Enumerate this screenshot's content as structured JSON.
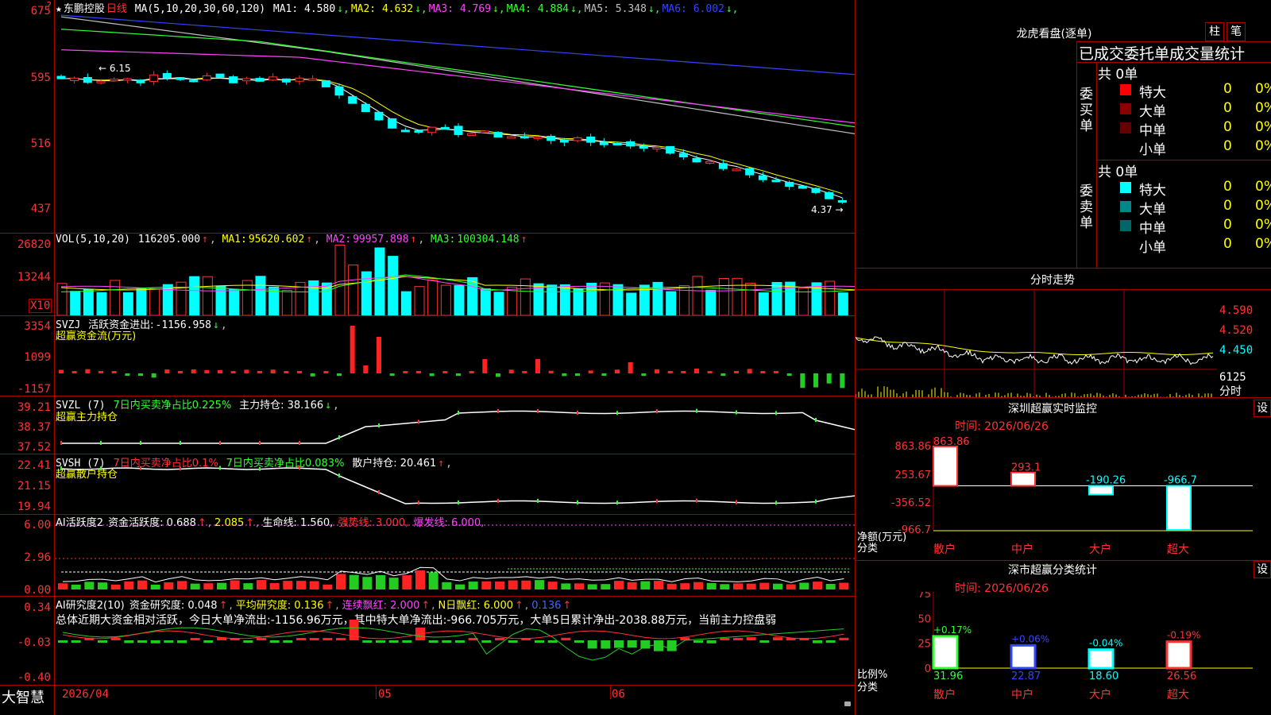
{
  "app": {
    "brand": "大智慧"
  },
  "main_chart": {
    "star": "★",
    "stock_name": "东鹏控股",
    "period": "日线",
    "ma_label": "MA(5,10,20,30,60,120)",
    "ma_values": [
      {
        "label": "MA1:",
        "value": "4.580",
        "arrow": "↓",
        "color": "#ffffff"
      },
      {
        "label": "MA2:",
        "value": "4.632",
        "arrow": "↓",
        "color": "#ffff00"
      },
      {
        "label": "MA3:",
        "value": "4.769",
        "arrow": "↓",
        "color": "#ff44ff"
      },
      {
        "label": "MA4:",
        "value": "4.884",
        "arrow": "↓",
        "color": "#33ff33"
      },
      {
        "label": "MA5:",
        "value": "5.348",
        "arrow": "↓",
        "color": "#c0c0c0"
      },
      {
        "label": "MA6:",
        "value": "6.002",
        "arrow": "↓",
        "color": "#3344ff"
      }
    ],
    "y_ticks": [
      "675",
      "595",
      "516",
      "437"
    ],
    "top_marker": "?",
    "high_label": "6.15",
    "low_label": "4.37"
  },
  "vol_panel": {
    "label": "VOL(5,10,20)",
    "value": "116205.000",
    "ma1": "95620.602",
    "ma2": "99957.898",
    "ma3": "100304.148",
    "y_ticks": [
      "26820",
      "13244"
    ],
    "unit_badge": "X10"
  },
  "svzj_panel": {
    "label": "SVZJ",
    "desc": "活跃资金进出:",
    "value": "-1156.958",
    "sub": "超赢资金流(万元)",
    "y_ticks": [
      "3354",
      "1099",
      "-1157"
    ]
  },
  "svzl_panel": {
    "label": "SVZL (7)",
    "desc": "7日内买卖净占比0.225%",
    "hold": "主力持仓: 38.166",
    "sub": "超赢主力持仓",
    "y_ticks": [
      "39.21",
      "38.37",
      "37.52"
    ]
  },
  "svsh_panel": {
    "label": "SVSH (7)",
    "desc1": "7日内买卖净占比0.1%",
    "desc2": "7日内买卖净占比0.083%",
    "hold": "散户持仓: 20.461",
    "sub": "超赢散户持仓",
    "y_ticks": [
      "22.41",
      "21.15",
      "19.94"
    ]
  },
  "ai_active_panel": {
    "label": "AI活跃度2",
    "desc": "资金活跃度: 0.688",
    "v2": "2.085",
    "life": "生命线: 1.560,",
    "strong": "强势线: 3.000,",
    "burst": "爆发线: 6.000,",
    "y_ticks": [
      "6.00",
      "2.96",
      "0.00"
    ]
  },
  "ai_research_panel": {
    "label": "AI研究度2(10)",
    "desc": "资金研究度: 0.048",
    "avg": "平均研究度: 0.136",
    "cont": "连续飘红: 2.000",
    "nday": "N日飘红: 6.000",
    "last": "0.136",
    "summary": "总体近期大资金相对活跃，今日大单净流出:-1156.96万元，其中特大单净流出:-966.705万元，大单5日累计净出-2038.88万元，当前主力控盘弱",
    "y_ticks": [
      "0.34",
      "-0.03",
      "-0.40"
    ]
  },
  "x_axis": {
    "labels": [
      "2026/04",
      "05",
      "06"
    ]
  },
  "dragon_tiger": {
    "title": "龙虎看盘(逐单)",
    "btn_zhu": "柱",
    "btn_bi": "笔",
    "table_title": "已成交委托单成交量统计",
    "buy_label": "委买单",
    "sell_label": "委卖单",
    "buy_total": "共 0单",
    "sell_total": "共 0单",
    "buy_rows": [
      {
        "name": "特大",
        "count": "0",
        "pct": "0%",
        "color": "#ff0000"
      },
      {
        "name": "大单",
        "count": "0",
        "pct": "0%",
        "color": "#880000"
      },
      {
        "name": "中单",
        "count": "0",
        "pct": "0%",
        "color": "#660000"
      },
      {
        "name": "小单",
        "count": "0",
        "pct": "0%",
        "color": "#000000"
      }
    ],
    "sell_rows": [
      {
        "name": "特大",
        "count": "0",
        "pct": "0%",
        "color": "#00ffff"
      },
      {
        "name": "大单",
        "count": "0",
        "pct": "0%",
        "color": "#008888"
      },
      {
        "name": "中单",
        "count": "0",
        "pct": "0%",
        "color": "#006666"
      },
      {
        "name": "小单",
        "count": "0",
        "pct": "0%",
        "color": "#000000"
      }
    ]
  },
  "intraday": {
    "title": "分时走势",
    "prices": [
      "4.590",
      "4.520",
      "4.450"
    ],
    "vol": "6125",
    "vol_label": "分时"
  },
  "sz_monitor": {
    "title": "深圳超赢实时监控",
    "btn": "设",
    "time": "时间: 2026/06/26",
    "y_ticks": [
      "863.86",
      "253.67",
      "-356.52",
      "-966.7"
    ],
    "ylabel": "净额(万元)",
    "xlabel": "分类",
    "categories": [
      "散户",
      "中户",
      "大户",
      "超大"
    ],
    "values": [
      863.86,
      293.1,
      -190.26,
      -966.7
    ],
    "value_labels": [
      "863.86",
      "293.1",
      "-190.26",
      "-966.7"
    ]
  },
  "sz_class": {
    "title": "深市超赢分类统计",
    "btn": "设",
    "time": "时间: 2026/06/26",
    "y_ticks": [
      "75",
      "50",
      "25",
      "0"
    ],
    "ylabel": "比例%",
    "xlabel": "分类",
    "categories": [
      "散户",
      "中户",
      "大户",
      "超大"
    ],
    "values": [
      31.96,
      22.87,
      18.6,
      26.56
    ],
    "value_labels": [
      "31.96",
      "22.87",
      "18.60",
      "26.56"
    ],
    "changes": [
      "+0.17%",
      "+0.06%",
      "-0.04%",
      "-0.19%"
    ],
    "colors": [
      "#33ff33",
      "#3344ff",
      "#00ffff",
      "#ff3333"
    ]
  },
  "chart_data": {
    "type": "bar",
    "title": "深市超赢分类统计",
    "categories": [
      "散户",
      "中户",
      "大户",
      "超大"
    ],
    "values": [
      31.96,
      22.87,
      18.6,
      26.56
    ],
    "ylabel": "比例%",
    "ylim": [
      0,
      75
    ]
  }
}
